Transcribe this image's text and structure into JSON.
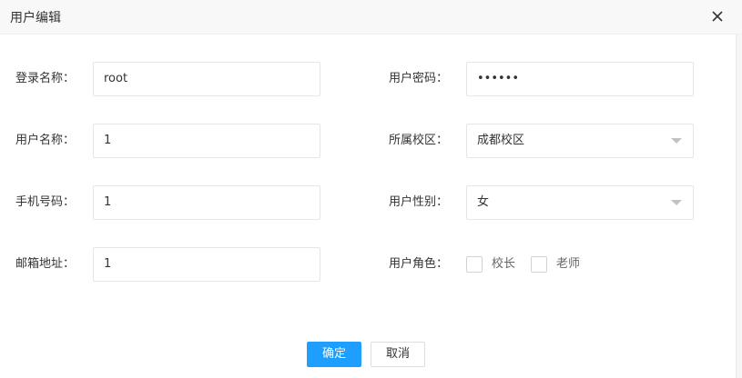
{
  "dialog": {
    "title": "用户编辑",
    "close_icon": "close-icon"
  },
  "form": {
    "login_name": {
      "label": "登录名称：",
      "value": "root"
    },
    "password": {
      "label": "用户密码：",
      "value": "••••••"
    },
    "user_name": {
      "label": "用户名称：",
      "value": "1"
    },
    "campus": {
      "label": "所属校区：",
      "value": "成都校区"
    },
    "phone": {
      "label": "手机号码：",
      "value": "1"
    },
    "gender": {
      "label": "用户性别：",
      "value": "女"
    },
    "email": {
      "label": "邮箱地址：",
      "value": "1"
    },
    "role": {
      "label": "用户角色：",
      "options": [
        {
          "label": "校长",
          "checked": false
        },
        {
          "label": "老师",
          "checked": false
        }
      ]
    }
  },
  "buttons": {
    "confirm": "确定",
    "cancel": "取消"
  },
  "colors": {
    "primary": "#1e9fff",
    "border": "#e6e6e6"
  }
}
